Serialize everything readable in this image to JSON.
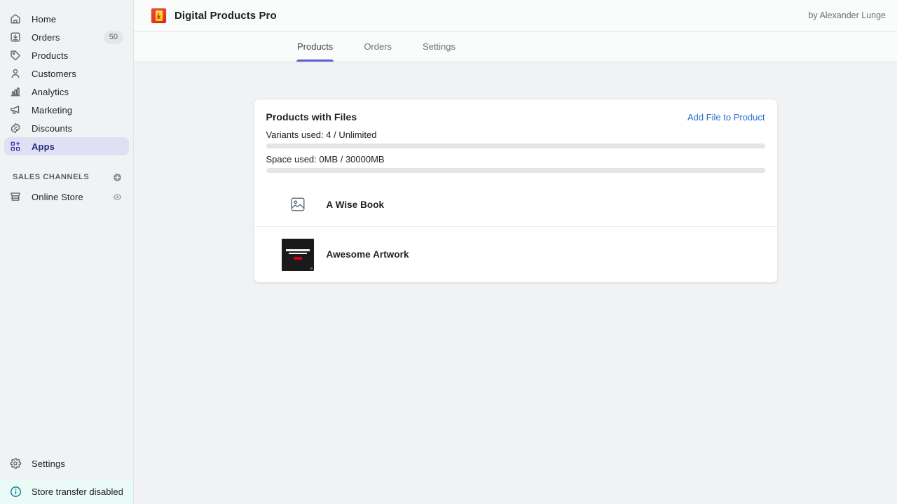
{
  "sidebar": {
    "nav_items": [
      {
        "label": "Home",
        "icon": "home-icon",
        "badge": null,
        "active": false
      },
      {
        "label": "Orders",
        "icon": "orders-icon",
        "badge": "50",
        "active": false
      },
      {
        "label": "Products",
        "icon": "products-icon",
        "badge": null,
        "active": false
      },
      {
        "label": "Customers",
        "icon": "customers-icon",
        "badge": null,
        "active": false
      },
      {
        "label": "Analytics",
        "icon": "analytics-icon",
        "badge": null,
        "active": false
      },
      {
        "label": "Marketing",
        "icon": "marketing-icon",
        "badge": null,
        "active": false
      },
      {
        "label": "Discounts",
        "icon": "discounts-icon",
        "badge": null,
        "active": false
      },
      {
        "label": "Apps",
        "icon": "apps-icon",
        "badge": null,
        "active": true
      }
    ],
    "sales_channels": {
      "title": "SALES CHANNELS",
      "add_icon": "plus-circle-icon",
      "items": [
        {
          "label": "Online Store",
          "icon": "store-icon",
          "action_icon": "eye-icon"
        }
      ]
    },
    "settings": {
      "label": "Settings",
      "icon": "gear-icon"
    },
    "store_transfer": {
      "label": "Store transfer disabled",
      "icon": "info-circle-icon",
      "accent": "#00848e"
    }
  },
  "topbar": {
    "app_icon": "download-app-icon",
    "title": "Digital Products Pro",
    "byline": "by Alexander Lunge"
  },
  "tabs": [
    {
      "label": "Products",
      "active": true
    },
    {
      "label": "Orders",
      "active": false
    },
    {
      "label": "Settings",
      "active": false
    }
  ],
  "card": {
    "title": "Products with Files",
    "action_label": "Add File to Product",
    "action_color": "#2c6ecb",
    "meters": [
      {
        "label": "Variants used: 4 / Unlimited",
        "percent": 0
      },
      {
        "label": "Space used: 0MB / 30000MB",
        "percent": 0
      }
    ],
    "products": [
      {
        "name": "A Wise Book",
        "thumb": "image-placeholder-icon"
      },
      {
        "name": "Awesome Artwork",
        "thumb": "poster-thumbnail"
      }
    ]
  },
  "colors": {
    "accent_indigo": "#5c5fd4",
    "link_blue": "#2c6ecb",
    "active_nav_bg": "#e0e0f5",
    "page_bg": "#f1f2f4",
    "teal": "#00848e"
  }
}
